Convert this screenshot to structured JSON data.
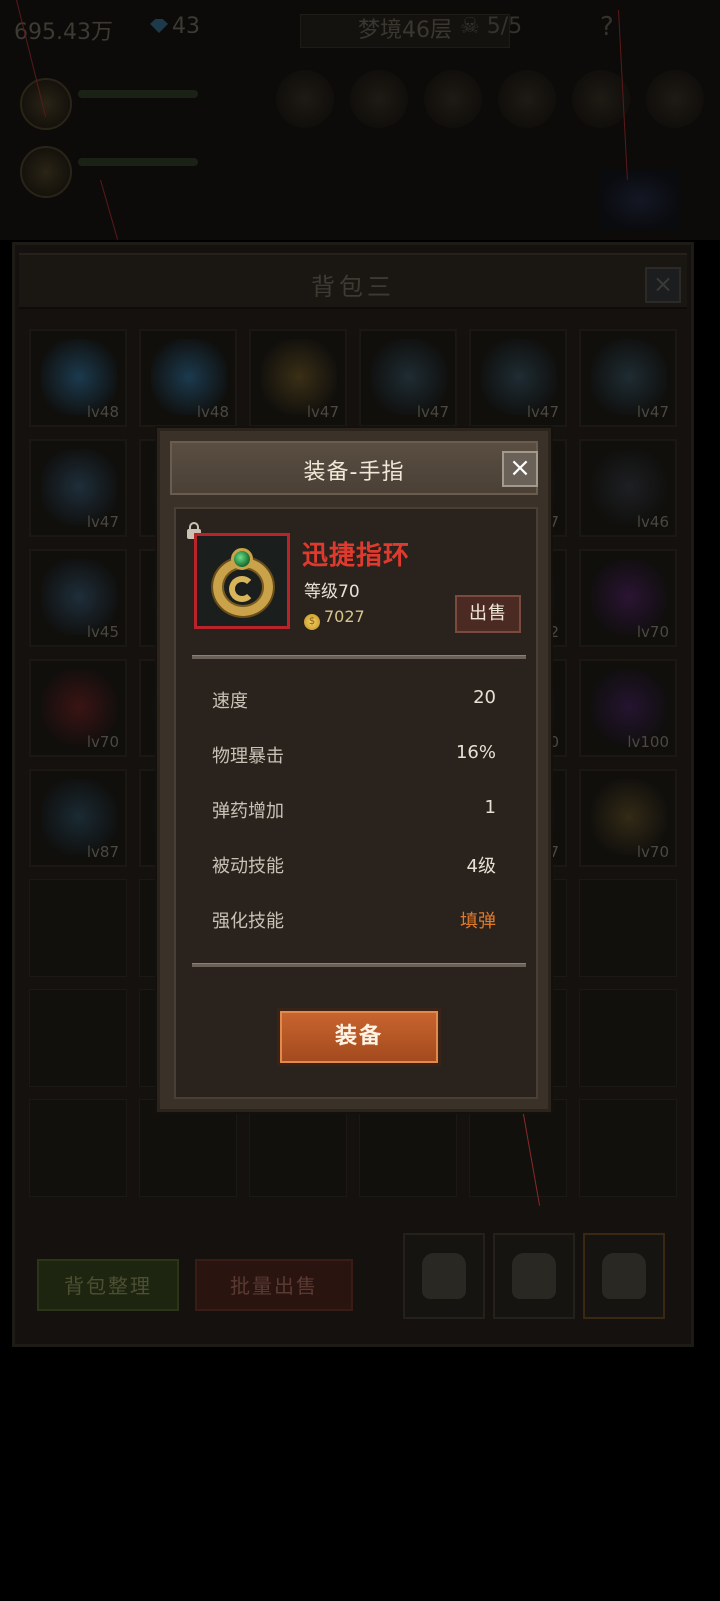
{
  "hud": {
    "gold": "695.43万",
    "gems": "43",
    "stage": "梦境46层",
    "keys": "5/5",
    "help": "?"
  },
  "backpack": {
    "title": "背包三",
    "close_icon": "close-icon",
    "slots": [
      {
        "lv": "lv48",
        "color": "#1b3a4e"
      },
      {
        "lv": "lv48",
        "color": "#1b3a4e"
      },
      {
        "lv": "lv47",
        "color": "#3a2f16"
      },
      {
        "lv": "lv47",
        "color": "#1e2c33"
      },
      {
        "lv": "lv47",
        "color": "#1e2c33"
      },
      {
        "lv": "lv47",
        "color": "#1e2c33"
      },
      {
        "lv": "lv47",
        "color": "#1e2e3a"
      },
      {
        "lv": "",
        "color": "#16181a"
      },
      {
        "lv": "",
        "color": "#16181a"
      },
      {
        "lv": "",
        "color": "#16181a"
      },
      {
        "lv": "7",
        "color": "#16181a"
      },
      {
        "lv": "lv46",
        "color": "#1d1f22"
      },
      {
        "lv": "lv45",
        "color": "#1e2e3a"
      },
      {
        "lv": "",
        "color": "#16181a"
      },
      {
        "lv": "",
        "color": "#16181a"
      },
      {
        "lv": "",
        "color": "#16181a"
      },
      {
        "lv": "2",
        "color": "#16181a"
      },
      {
        "lv": "lv70",
        "color": "#2a1433"
      },
      {
        "lv": "lv70",
        "color": "#3a1414"
      },
      {
        "lv": "",
        "color": "#16181a"
      },
      {
        "lv": "",
        "color": "#16181a"
      },
      {
        "lv": "",
        "color": "#16181a"
      },
      {
        "lv": "00",
        "color": "#16181a"
      },
      {
        "lv": "lv100",
        "color": "#241430"
      },
      {
        "lv": "lv87",
        "color": "#1a2a33"
      },
      {
        "lv": "",
        "color": "#16181a"
      },
      {
        "lv": "",
        "color": "#16181a"
      },
      {
        "lv": "",
        "color": "#16181a"
      },
      {
        "lv": "7",
        "color": "#16181a"
      },
      {
        "lv": "lv70",
        "color": "#332a16"
      }
    ],
    "buttons": {
      "organize": "背包整理",
      "batch_sell": "批量出售"
    },
    "tabs": [
      "backpack-1",
      "backpack-2",
      "backpack-3"
    ]
  },
  "dialog": {
    "title": "装备-手指",
    "item": {
      "name": "迅捷指环",
      "level": "等级70",
      "price": "7027",
      "locked": true
    },
    "sell_label": "出售",
    "stats": [
      {
        "label": "速度",
        "value": "20"
      },
      {
        "label": "物理暴击",
        "value": "16%"
      },
      {
        "label": "弹药增加",
        "value": "1"
      },
      {
        "label": "被动技能",
        "value": "4级"
      },
      {
        "label": "强化技能",
        "value": "填弹"
      }
    ],
    "equip_label": "装备",
    "colors": {
      "item_name": "#e03a2f",
      "highlight_value": "#e07a2a",
      "equip_button": "#b8542a",
      "rarity_border": "#b8242a"
    }
  }
}
